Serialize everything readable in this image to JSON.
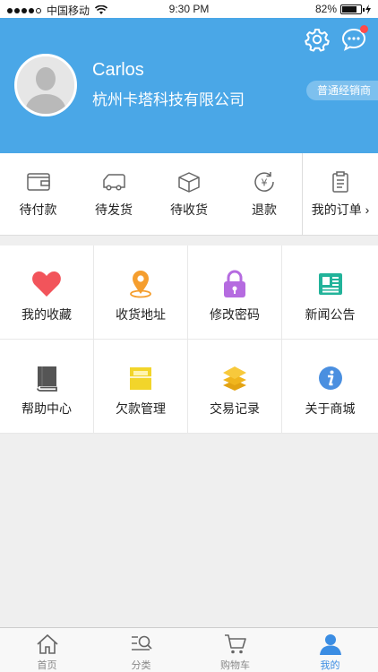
{
  "status_bar": {
    "carrier": "中国移动",
    "time": "9:30 PM",
    "battery": "82%",
    "battery_level": 0.82
  },
  "profile": {
    "name": "Carlos",
    "company": "杭州卡塔科技有限公司",
    "role_badge": "普通经销商"
  },
  "orders": {
    "items": [
      {
        "label": "待付款",
        "icon": "wallet-icon"
      },
      {
        "label": "待发货",
        "icon": "truck-icon"
      },
      {
        "label": "待收货",
        "icon": "box-icon"
      },
      {
        "label": "退款",
        "icon": "refund-icon"
      }
    ],
    "my_orders": {
      "label": "我的订单",
      "icon": "clipboard-icon"
    }
  },
  "grid": [
    {
      "label": "我的收藏",
      "icon": "heart-icon",
      "color": "#f2545b"
    },
    {
      "label": "收货地址",
      "icon": "location-icon",
      "color": "#f59e2e"
    },
    {
      "label": "修改密码",
      "icon": "lock-icon",
      "color": "#b56be0"
    },
    {
      "label": "新闻公告",
      "icon": "news-icon",
      "color": "#22b39a"
    },
    {
      "label": "帮助中心",
      "icon": "book-icon",
      "color": "#555555"
    },
    {
      "label": "欠款管理",
      "icon": "folder-icon",
      "color": "#f2d52a"
    },
    {
      "label": "交易记录",
      "icon": "layers-icon",
      "color": "#f0b51d"
    },
    {
      "label": "关于商城",
      "icon": "info-icon",
      "color": "#4a8fe0"
    }
  ],
  "tabbar": [
    {
      "label": "首页",
      "icon": "home-icon",
      "active": false
    },
    {
      "label": "分类",
      "icon": "category-icon",
      "active": false
    },
    {
      "label": "购物车",
      "icon": "cart-icon",
      "active": false
    },
    {
      "label": "我的",
      "icon": "user-icon",
      "active": true
    }
  ],
  "colors": {
    "header": "#4aa7e7",
    "active_tab": "#3b8de3"
  }
}
